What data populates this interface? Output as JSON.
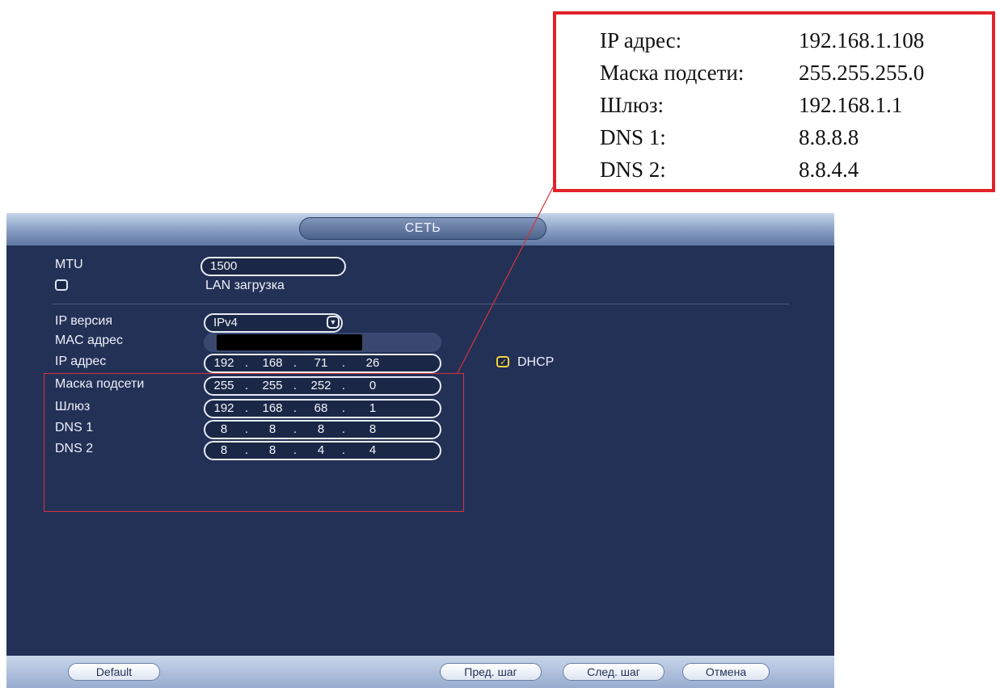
{
  "callout": {
    "rows": [
      {
        "label": "IP адрес:",
        "value": "192.168.1.108"
      },
      {
        "label": "Маска подсети:",
        "value": "255.255.255.0"
      },
      {
        "label": "Шлюз:",
        "value": "192.168.1.1"
      },
      {
        "label": "DNS 1:",
        "value": "8.8.8.8"
      },
      {
        "label": "DNS 2:",
        "value": "8.8.4.4"
      }
    ]
  },
  "window": {
    "title": "СЕТЬ",
    "mtu": {
      "label": "MTU",
      "value": "1500"
    },
    "lan_download": {
      "label": "LAN загрузка",
      "checked": false
    },
    "ip_version": {
      "label": "IP версия",
      "value": "IPv4"
    },
    "mac": {
      "label": "MAC адрес"
    },
    "ip": {
      "label": "IP адрес",
      "octets": [
        "192",
        "168",
        "71",
        "26"
      ]
    },
    "mask": {
      "label": "Маска подсети",
      "octets": [
        "255",
        "255",
        "252",
        "0"
      ]
    },
    "gateway": {
      "label": "Шлюз",
      "octets": [
        "192",
        "168",
        "68",
        "1"
      ]
    },
    "dns1": {
      "label": "DNS 1",
      "octets": [
        "8",
        "8",
        "8",
        "8"
      ]
    },
    "dns2": {
      "label": "DNS 2",
      "octets": [
        "8",
        "8",
        "4",
        "4"
      ]
    },
    "dhcp": {
      "label": "DHCP",
      "checked": true
    }
  },
  "buttons": {
    "default": "Default",
    "prev": "Пред. шаг",
    "next": "След. шаг",
    "cancel": "Отмена"
  },
  "colors": {
    "highlight": "#e2222b",
    "window_bg": "#233157",
    "checkbox_checked": "#f0d346"
  }
}
